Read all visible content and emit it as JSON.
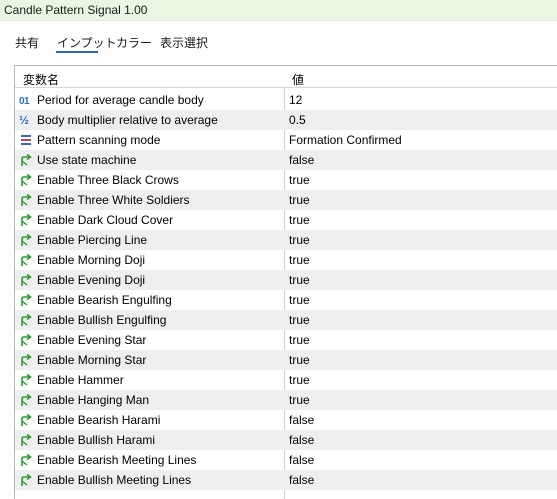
{
  "window": {
    "title": "Candle Pattern Signal 1.00"
  },
  "tabs": [
    {
      "label": "共有"
    },
    {
      "label": "インプット"
    },
    {
      "label": "カラー"
    },
    {
      "label": "表示選択"
    }
  ],
  "table": {
    "headers": {
      "name": "変数名",
      "value": "値"
    },
    "rows": [
      {
        "icon": "int-icon",
        "name": "Period for average candle body",
        "value": "12"
      },
      {
        "icon": "fraction-icon",
        "name": "Body multiplier relative to average",
        "value": "0.5"
      },
      {
        "icon": "enum-list-icon",
        "name": "Pattern scanning mode",
        "value": "Formation Confirmed"
      },
      {
        "icon": "bool-arrow-icon",
        "name": "Use state machine",
        "value": "false"
      },
      {
        "icon": "bool-arrow-icon",
        "name": "Enable Three Black Crows",
        "value": "true"
      },
      {
        "icon": "bool-arrow-icon",
        "name": "Enable Three White Soldiers",
        "value": "true"
      },
      {
        "icon": "bool-arrow-icon",
        "name": "Enable Dark Cloud Cover",
        "value": "true"
      },
      {
        "icon": "bool-arrow-icon",
        "name": "Enable Piercing Line",
        "value": "true"
      },
      {
        "icon": "bool-arrow-icon",
        "name": "Enable Morning Doji",
        "value": "true"
      },
      {
        "icon": "bool-arrow-icon",
        "name": "Enable Evening Doji",
        "value": "true"
      },
      {
        "icon": "bool-arrow-icon",
        "name": "Enable Bearish Engulfing",
        "value": "true"
      },
      {
        "icon": "bool-arrow-icon",
        "name": "Enable Bullish Engulfing",
        "value": "true"
      },
      {
        "icon": "bool-arrow-icon",
        "name": "Enable Evening Star",
        "value": "true"
      },
      {
        "icon": "bool-arrow-icon",
        "name": "Enable Morning Star",
        "value": "true"
      },
      {
        "icon": "bool-arrow-icon",
        "name": "Enable Hammer",
        "value": "true"
      },
      {
        "icon": "bool-arrow-icon",
        "name": "Enable Hanging Man",
        "value": "true"
      },
      {
        "icon": "bool-arrow-icon",
        "name": "Enable Bearish Harami",
        "value": "false"
      },
      {
        "icon": "bool-arrow-icon",
        "name": "Enable Bullish Harami",
        "value": "false"
      },
      {
        "icon": "bool-arrow-icon",
        "name": "Enable Bearish Meeting Lines",
        "value": "false"
      },
      {
        "icon": "bool-arrow-icon",
        "name": "Enable Bullish Meeting Lines",
        "value": "false"
      }
    ]
  },
  "colors": {
    "titlebar_bg": "#e8f6e2",
    "accent": "#2b66c9",
    "bool_icon": "#2e9a2e",
    "alt_row": "#eeeeee"
  }
}
